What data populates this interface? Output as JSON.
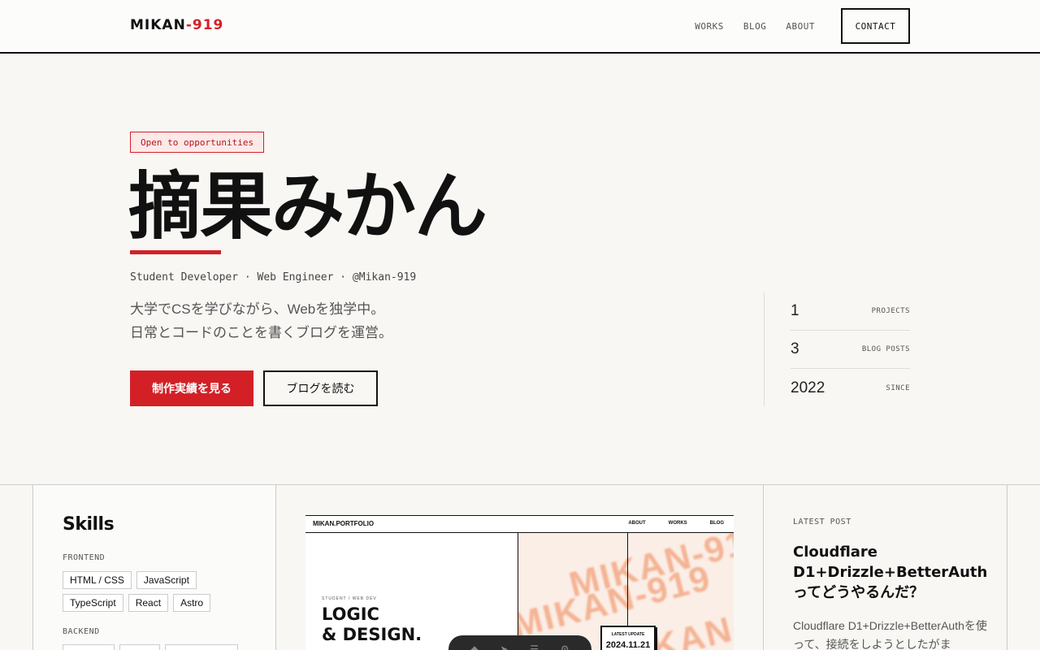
{
  "header": {
    "logo_main": "MIKAN",
    "logo_accent": "-919",
    "nav": [
      "WORKS",
      "BLOG",
      "ABOUT"
    ],
    "contact_label": "CONTACT"
  },
  "hero": {
    "badge": "Open to opportunities",
    "title": "摘果みかん",
    "roles": "Student Developer · Web Engineer · @Mikan-919",
    "intro_line1": "大学でCSを学びながら、Webを独学中。",
    "intro_line2": "日常とコードのことを書くブログを運営。",
    "primary_button": "制作実績を見る",
    "secondary_button": "ブログを読む",
    "accent_color": "#d32027"
  },
  "stats": [
    {
      "value": "1",
      "label": "PROJECTS"
    },
    {
      "value": "3",
      "label": "BLOG POSTS"
    },
    {
      "value": "2022",
      "label": "SINCE"
    }
  ],
  "skills": {
    "title": "Skills",
    "frontend_label": "FRONTEND",
    "frontend": [
      "HTML / CSS",
      "JavaScript",
      "TypeScript",
      "React",
      "Astro"
    ],
    "backend_label": "BACKEND"
  },
  "preview": {
    "logo": "MIKAN.PORTFOLIO",
    "links": [
      "ABOUT",
      "WORKS",
      "BLOG"
    ],
    "small": "STUDENT / WEB DEV",
    "hero_line1": "LOGIC",
    "hero_line2": "& DESIGN.",
    "update_label": "LATEST UPDATE",
    "update_date": "2024.11.21",
    "art_text": "MIKAN-919"
  },
  "latest_post": {
    "label": "LATEST POST",
    "title": "Cloudflare D1+Drizzle+BetterAuthってどうやるんだ？",
    "excerpt": "Cloudflare D1+Drizzle+BetterAuthを使って、接続をしようとしたがま"
  }
}
